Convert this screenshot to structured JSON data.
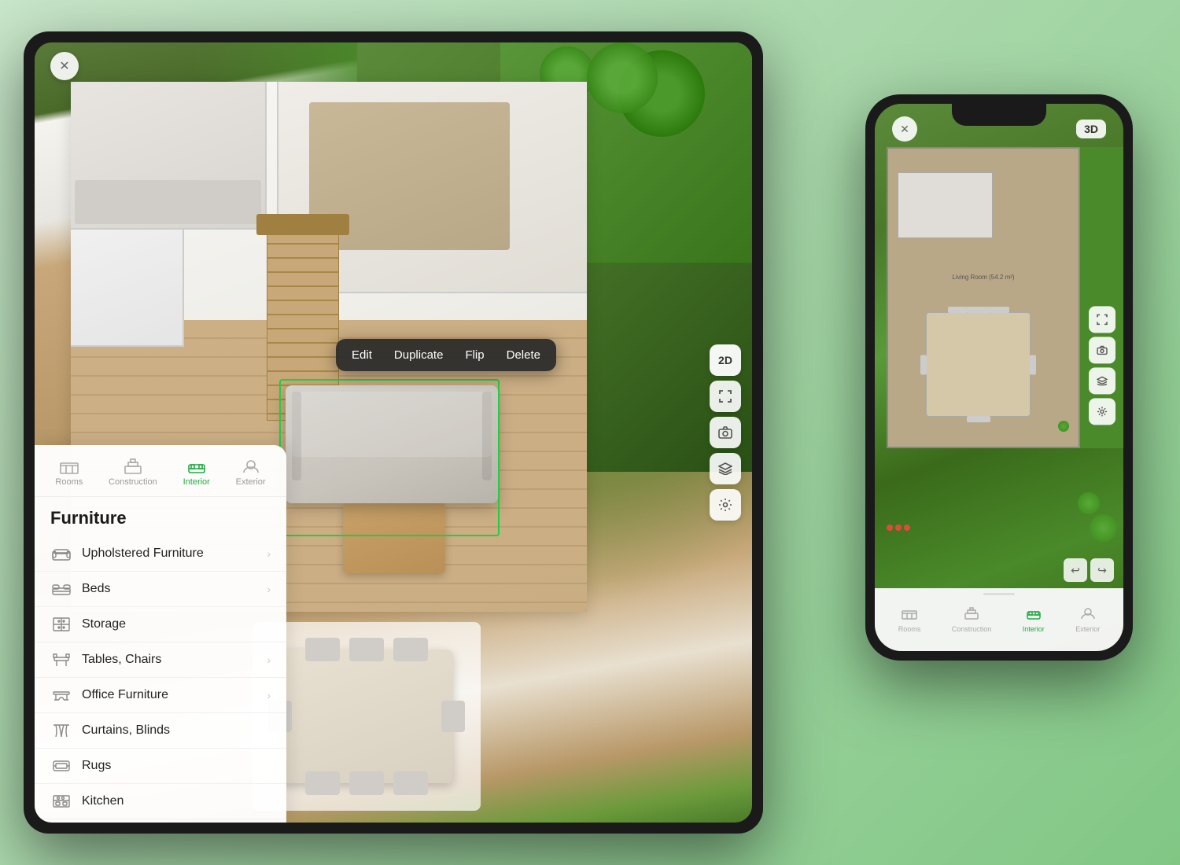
{
  "scene": {
    "bg_color": "#c8e6a0"
  },
  "tablet": {
    "close_btn": "✕",
    "view_mode": "2D",
    "topbar_close": "×",
    "toolbar": {
      "buttons": [
        {
          "id": "2d",
          "label": "2D",
          "type": "text"
        },
        {
          "id": "fullscreen",
          "label": "⤢",
          "type": "icon"
        },
        {
          "id": "camera",
          "label": "📷",
          "type": "icon"
        },
        {
          "id": "layers",
          "label": "◫",
          "type": "icon"
        },
        {
          "id": "settings",
          "label": "⚙",
          "type": "icon"
        }
      ]
    },
    "context_menu": {
      "items": [
        "Edit",
        "Duplicate",
        "Flip",
        "Delete"
      ]
    },
    "sidebar": {
      "tabs": [
        {
          "id": "rooms",
          "label": "Rooms",
          "active": false
        },
        {
          "id": "construction",
          "label": "Construction",
          "active": false
        },
        {
          "id": "interior",
          "label": "Interior",
          "active": true
        },
        {
          "id": "exterior",
          "label": "Exterior",
          "active": false
        }
      ],
      "title": "Furniture",
      "items": [
        {
          "id": "upholstered",
          "label": "Upholstered Furniture",
          "has_chevron": true
        },
        {
          "id": "beds",
          "label": "Beds",
          "has_chevron": true
        },
        {
          "id": "storage",
          "label": "Storage",
          "has_chevron": false
        },
        {
          "id": "tables-chairs",
          "label": "Tables, Chairs",
          "has_chevron": true
        },
        {
          "id": "office",
          "label": "Office Furniture",
          "has_chevron": true
        },
        {
          "id": "curtains",
          "label": "Curtains, Blinds",
          "has_chevron": false
        },
        {
          "id": "rugs",
          "label": "Rugs",
          "has_chevron": false
        },
        {
          "id": "kitchen",
          "label": "Kitchen",
          "has_chevron": false
        }
      ]
    }
  },
  "phone": {
    "close_btn": "✕",
    "view_mode": "3D",
    "floor_plan_label": "Living Room (54.2 m²)",
    "toolbar": {
      "buttons": [
        {
          "id": "fullscreen",
          "label": "⤢"
        },
        {
          "id": "camera",
          "label": "⊙"
        },
        {
          "id": "layers",
          "label": "◫"
        },
        {
          "id": "settings",
          "label": "⚙"
        }
      ]
    },
    "undo_redo": {
      "undo": "↩",
      "redo": "↪"
    },
    "bottom_tabs": [
      {
        "id": "rooms",
        "label": "Rooms",
        "active": false
      },
      {
        "id": "construction",
        "label": "Construction",
        "active": false
      },
      {
        "id": "interior",
        "label": "Interior",
        "active": true
      },
      {
        "id": "exterior",
        "label": "Exterior",
        "active": false
      }
    ]
  }
}
